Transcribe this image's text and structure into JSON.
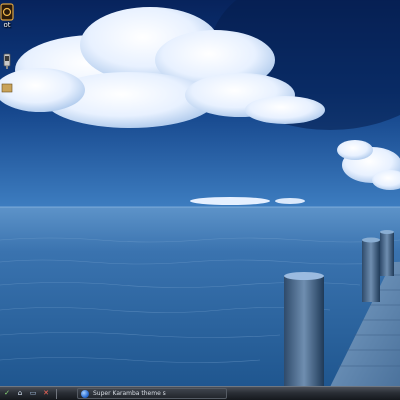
{
  "desktop": {
    "wallpaper": "ocean with wooden pier and clouds",
    "icons": [
      {
        "label": "ot",
        "icon": "app-icon"
      },
      {
        "label": "",
        "icon": "launcher-icon"
      },
      {
        "label": "",
        "icon": "folder-icon"
      }
    ]
  },
  "taskbar": {
    "quick_launch": [
      {
        "icon": "check-icon",
        "glyph": "✓"
      },
      {
        "icon": "home-icon",
        "glyph": "⌂"
      },
      {
        "icon": "monitor-icon",
        "glyph": "▭"
      },
      {
        "icon": "close-icon",
        "glyph": "✕"
      }
    ],
    "task_label": "Super Karamba theme s"
  },
  "colors": {
    "sky_top": "#0c2b68",
    "sea": "#2f6aa5",
    "taskbar": "#2a2e35"
  }
}
